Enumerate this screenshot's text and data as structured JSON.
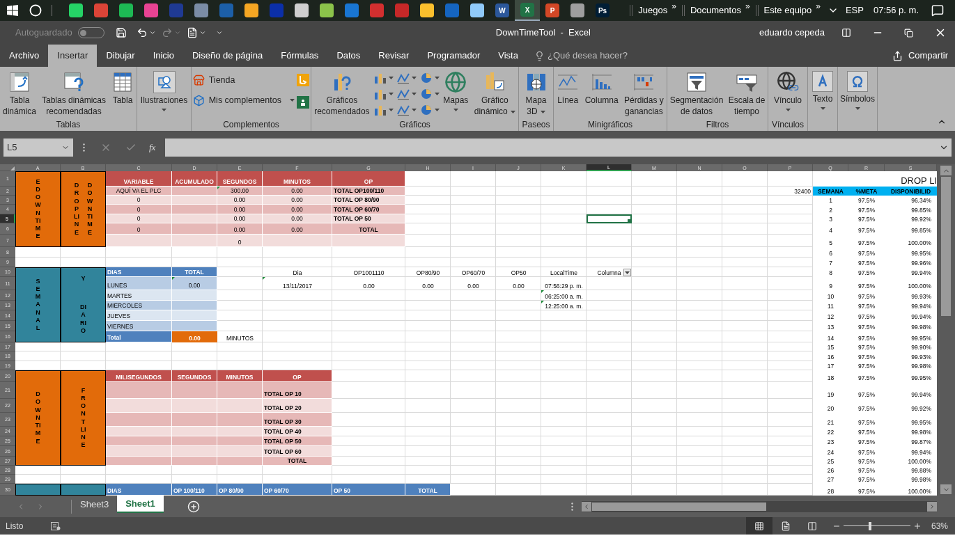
{
  "taskbar": {
    "apps": [
      {
        "color": "#25d366",
        "selected": false
      },
      {
        "color": "#db4437",
        "selected": false
      },
      {
        "color": "#1db954",
        "selected": false
      },
      {
        "color": "#e84393",
        "selected": false
      },
      {
        "color": "#1f3a93",
        "selected": false
      },
      {
        "color": "#7a8ca5",
        "selected": false
      },
      {
        "color": "#1c5fa8",
        "selected": false
      },
      {
        "color": "#f5a623",
        "selected": false
      },
      {
        "color": "#0b2fa8",
        "selected": false
      },
      {
        "color": "#cfcfcf",
        "selected": false
      },
      {
        "color": "#8bc34a",
        "selected": false
      },
      {
        "color": "#1976d2",
        "selected": false
      },
      {
        "color": "#d32f2f",
        "selected": false
      },
      {
        "color": "#c62828",
        "selected": false
      },
      {
        "color": "#fbc02d",
        "selected": false
      },
      {
        "color": "#1565c0",
        "selected": false
      },
      {
        "color": "#90caf9",
        "selected": false
      },
      {
        "color": "#2b579a",
        "label": "W",
        "selected": false
      },
      {
        "color": "#217346",
        "label": "X",
        "selected": true
      },
      {
        "color": "#d24726",
        "label": "P",
        "selected": false
      },
      {
        "color": "#9e9e9e",
        "selected": false
      },
      {
        "color": "#001e36",
        "label": "Ps",
        "selected": false
      }
    ],
    "toolbars": [
      {
        "label": "Juegos",
        "more": "»"
      },
      {
        "label": "Documentos",
        "more": "»"
      },
      {
        "label": "Este equipo",
        "more": "»"
      }
    ],
    "language": "ESP",
    "clock": "07:56 p. m."
  },
  "window": {
    "autosave": {
      "label": "Autoguardado",
      "on": false
    },
    "title": "DownTimeTool  -  Excel",
    "user": "eduardo cepeda"
  },
  "tabs": [
    {
      "label": "Archivo",
      "selected": false
    },
    {
      "label": "Insertar",
      "selected": true
    },
    {
      "label": "Dibujar",
      "selected": false
    },
    {
      "label": "Inicio",
      "selected": false
    },
    {
      "label": "Diseño de página",
      "selected": false
    },
    {
      "label": "Fórmulas",
      "selected": false
    },
    {
      "label": "Datos",
      "selected": false
    },
    {
      "label": "Revisar",
      "selected": false
    },
    {
      "label": "Programador",
      "selected": false
    },
    {
      "label": "Vista",
      "selected": false
    }
  ],
  "tell_me": {
    "placeholder": "¿Qué desea hacer?"
  },
  "share": "Compartir",
  "ribbon": {
    "tables": {
      "label": "Tablas",
      "pivot": [
        "Tabla",
        "dinámica"
      ],
      "recommended_pivot": [
        "Tablas dinámicas",
        "recomendadas"
      ],
      "table": [
        "Tabla"
      ]
    },
    "illustrations": [
      "Ilustraciones"
    ],
    "addins": {
      "label": "Complementos",
      "store": "Tienda",
      "my_addins": "Mis complementos"
    },
    "charts": {
      "label": "Gráficos",
      "recommended": [
        "Gráficos",
        "recomendados"
      ],
      "maps": [
        "Mapas"
      ],
      "pivot_chart": [
        "Gráfico",
        "dinámico"
      ]
    },
    "tours": {
      "label": "Paseos",
      "map3d": [
        "Mapa",
        "3D"
      ]
    },
    "sparklines": {
      "label": "Minigráficos",
      "line": [
        "Línea"
      ],
      "column": [
        "Columna"
      ],
      "winloss": [
        "Pérdidas y",
        "ganancias"
      ]
    },
    "filters": {
      "label": "Filtros",
      "slicer": [
        "Segmentación",
        "de datos"
      ],
      "timeline": [
        "Escala de",
        "tiempo"
      ]
    },
    "links": {
      "label": "Vínculos",
      "link": [
        "Vínculo"
      ]
    },
    "text": [
      "Texto"
    ],
    "symbols": [
      "Símbolos"
    ]
  },
  "formula_bar": {
    "name_box": "L5",
    "function": "fx"
  },
  "sheet": {
    "columns": [
      {
        "label": "A",
        "selected": false
      },
      {
        "label": "B",
        "selected": false
      },
      {
        "label": "C",
        "selected": false
      },
      {
        "label": "D",
        "selected": false
      },
      {
        "label": "E",
        "selected": false
      },
      {
        "label": "F",
        "selected": false
      },
      {
        "label": "G",
        "selected": false
      },
      {
        "label": "H",
        "selected": false
      },
      {
        "label": "I",
        "selected": false
      },
      {
        "label": "J",
        "selected": false
      },
      {
        "label": "K",
        "selected": false
      },
      {
        "label": "L",
        "selected": true
      },
      {
        "label": "M",
        "selected": false
      },
      {
        "label": "N",
        "selected": false
      },
      {
        "label": "O",
        "selected": false
      },
      {
        "label": "P",
        "selected": false
      },
      {
        "label": "Q",
        "selected": false
      },
      {
        "label": "R",
        "selected": false
      },
      {
        "label": "S",
        "selected": false
      }
    ],
    "blocks": [
      {
        "kind": "orange",
        "lines": [
          "EDOWNTIME"
        ]
      },
      {
        "kind": "orangepair",
        "lines": [
          "DROPLINE",
          "DOWNTIME"
        ]
      },
      {
        "kind": "teal",
        "lines": [
          "SEMANAL"
        ]
      },
      {
        "kind": "tealstack",
        "lines": [
          "Y",
          "DIARIO"
        ]
      },
      {
        "kind": "orange",
        "lines": [
          "DOWNTIME"
        ]
      },
      {
        "kind": "orange",
        "lines": [
          "FRONTLINE"
        ]
      },
      {
        "kind": "teal"
      },
      {
        "kind": "teal"
      }
    ],
    "rows": [
      {
        "label": "1",
        "selected": false,
        "cells": [
          {
            "kind": "header",
            "text": "VARIABLE"
          },
          {
            "kind": "header",
            "text": "ACUMULADO"
          },
          {
            "kind": "header",
            "text": "SEGUNDOS"
          },
          {
            "kind": "header",
            "text": "MINUTOS"
          },
          {
            "kind": "header",
            "text": "OP"
          }
        ]
      },
      {
        "label": "2",
        "selected": false,
        "cells": [
          {
            "kind": "shade",
            "text": "AQUÍ VA EL PLC"
          },
          {
            "kind": "shade"
          },
          {
            "kind": "shade",
            "text": "300.00",
            "flag": true
          },
          {
            "kind": "shade",
            "text": "0.00"
          },
          {
            "kind": "shadeop",
            "text": "TOTAL OP100/110"
          },
          {
            "kind": "plain"
          },
          {
            "kind": "plain"
          },
          {
            "kind": "plain"
          },
          {
            "kind": "plain"
          },
          {
            "kind": "plain"
          },
          {
            "kind": "plain"
          },
          {
            "kind": "plain"
          },
          {
            "kind": "plain"
          },
          {
            "kind": "figure",
            "text": "32400"
          }
        ]
      },
      {
        "label": "3",
        "selected": false,
        "cells": [
          {
            "kind": "tint",
            "text": "0"
          },
          {
            "kind": "tint"
          },
          {
            "kind": "tint",
            "text": "0.00"
          },
          {
            "kind": "tint",
            "text": "0.00"
          },
          {
            "kind": "tintop",
            "text": "TOTAL OP 80/90"
          }
        ]
      },
      {
        "label": "4",
        "selected": false,
        "cells": [
          {
            "kind": "shade",
            "text": "0"
          },
          {
            "kind": "shade"
          },
          {
            "kind": "shade",
            "text": "0.00"
          },
          {
            "kind": "shade",
            "text": "0.00"
          },
          {
            "kind": "shadeop",
            "text": "TOTAL OP 60/70"
          }
        ]
      },
      {
        "label": "5",
        "selected": true,
        "cells": [
          {
            "kind": "tint",
            "text": "0"
          },
          {
            "kind": "tint"
          },
          {
            "kind": "tint",
            "text": "0.00"
          },
          {
            "kind": "tint",
            "text": "0.00"
          },
          {
            "kind": "tintop",
            "text": "TOTAL OP 50"
          }
        ]
      },
      {
        "label": "6",
        "selected": false,
        "cells": [
          {
            "kind": "shade",
            "text": "0"
          },
          {
            "kind": "shade"
          },
          {
            "kind": "shade",
            "text": "0.00"
          },
          {
            "kind": "shade",
            "text": "0.00"
          },
          {
            "kind": "shadetotal",
            "text": "TOTAL"
          }
        ]
      },
      {
        "label": "7",
        "selected": false,
        "cells": [
          {
            "kind": "tint"
          },
          {
            "kind": "tint"
          },
          {
            "kind": "tint",
            "text": "0"
          },
          {
            "kind": "tint"
          },
          {
            "kind": "tint"
          }
        ]
      },
      {
        "label": "8",
        "selected": false
      },
      {
        "label": "9",
        "selected": false
      },
      {
        "label": "10",
        "selected": false,
        "cells": [
          {
            "kind": "bluetitle",
            "text": "DIAS"
          },
          {
            "kind": "bluehead",
            "text": "TOTAL"
          },
          {
            "kind": "plain"
          },
          {
            "kind": "plain",
            "text": "Dia"
          },
          {
            "kind": "plain",
            "text": "OP1001110"
          },
          {
            "kind": "plain",
            "text": "OP80/90"
          },
          {
            "kind": "plain",
            "text": "OP60/70"
          },
          {
            "kind": "plain",
            "text": "OP50"
          },
          {
            "kind": "plain",
            "text": "LocalTime"
          },
          {
            "kind": "plain",
            "text": "Columna",
            "filter": true
          }
        ]
      },
      {
        "label": "11",
        "selected": false,
        "cells": [
          {
            "kind": "daydark",
            "text": "LUNES"
          },
          {
            "kind": "bluedark",
            "text": "0.00",
            "flag": true
          },
          {
            "kind": "plain"
          },
          {
            "kind": "plain",
            "text": "13/11/2017",
            "flag": true
          },
          {
            "kind": "plain",
            "text": "0.00"
          },
          {
            "kind": "plain",
            "text": "0.00"
          },
          {
            "kind": "plain",
            "text": "0.00"
          },
          {
            "kind": "plain",
            "text": "0.00"
          },
          {
            "kind": "plain",
            "text": "07:56:29 p. m."
          }
        ]
      },
      {
        "label": "12",
        "selected": false,
        "cells": [
          {
            "kind": "daylight",
            "text": "MARTES"
          },
          {
            "kind": "bluelight"
          },
          {
            "kind": "plain"
          },
          {
            "kind": "plain"
          },
          {
            "kind": "plain"
          },
          {
            "kind": "plain"
          },
          {
            "kind": "plain"
          },
          {
            "kind": "plain"
          },
          {
            "kind": "plain",
            "text": "06:25:00 a. m.",
            "flag": true
          }
        ]
      },
      {
        "label": "13",
        "selected": false,
        "cells": [
          {
            "kind": "daydark",
            "text": "MIERCOLES"
          },
          {
            "kind": "bluedark"
          },
          {
            "kind": "plain"
          },
          {
            "kind": "plain"
          },
          {
            "kind": "plain"
          },
          {
            "kind": "plain"
          },
          {
            "kind": "plain"
          },
          {
            "kind": "plain"
          },
          {
            "kind": "plain",
            "text": "12:25:00 a. m.",
            "flag": true
          }
        ]
      },
      {
        "label": "14",
        "selected": false,
        "cells": [
          {
            "kind": "daylight",
            "text": "JUEVES"
          },
          {
            "kind": "bluelight"
          }
        ]
      },
      {
        "label": "15",
        "selected": false,
        "cells": [
          {
            "kind": "daydark",
            "text": "VIERNES"
          },
          {
            "kind": "bluedark"
          }
        ]
      },
      {
        "label": "16",
        "selected": false,
        "cells": [
          {
            "kind": "bluetitle",
            "text": "Total"
          },
          {
            "kind": "orange",
            "text": "0.00"
          },
          {
            "kind": "plain",
            "text": "MINUTOS"
          }
        ]
      },
      {
        "label": "17",
        "selected": false
      },
      {
        "label": "18",
        "selected": false
      },
      {
        "label": "19",
        "selected": false
      },
      {
        "label": "20",
        "selected": false,
        "cells": [
          {
            "kind": "header",
            "text": "MILISEGUNDOS"
          },
          {
            "kind": "header",
            "text": "SEGUNDOS"
          },
          {
            "kind": "header",
            "text": "MINUTOS"
          },
          {
            "kind": "header",
            "text": "OP"
          }
        ]
      },
      {
        "label": "21",
        "selected": false,
        "cells": [
          {
            "kind": "shade"
          },
          {
            "kind": "shade"
          },
          {
            "kind": "shade"
          },
          {
            "kind": "shadeop",
            "text": "TOTAL OP 10"
          }
        ]
      },
      {
        "label": "22",
        "selected": false,
        "cells": [
          {
            "kind": "tint"
          },
          {
            "kind": "tint"
          },
          {
            "kind": "tint"
          },
          {
            "kind": "tintop",
            "text": "TOTAL OP 20"
          }
        ]
      },
      {
        "label": "23",
        "selected": false,
        "cells": [
          {
            "kind": "shade"
          },
          {
            "kind": "shade"
          },
          {
            "kind": "shade"
          },
          {
            "kind": "shadeop",
            "text": "TOTAL OP 30"
          }
        ]
      },
      {
        "label": "24",
        "selected": false,
        "cells": [
          {
            "kind": "tint"
          },
          {
            "kind": "tint"
          },
          {
            "kind": "tint"
          },
          {
            "kind": "tintop",
            "text": "TOTAL OP 40"
          }
        ]
      },
      {
        "label": "25",
        "selected": false,
        "cells": [
          {
            "kind": "shade"
          },
          {
            "kind": "shade"
          },
          {
            "kind": "shade"
          },
          {
            "kind": "shadeop",
            "text": "TOTAL OP 50"
          }
        ]
      },
      {
        "label": "26",
        "selected": false,
        "cells": [
          {
            "kind": "tint"
          },
          {
            "kind": "tint"
          },
          {
            "kind": "tint"
          },
          {
            "kind": "tintop",
            "text": "TOTAL OP 60"
          }
        ]
      },
      {
        "label": "27",
        "selected": false,
        "cells": [
          {
            "kind": "shade"
          },
          {
            "kind": "shade"
          },
          {
            "kind": "shade"
          },
          {
            "kind": "shadetotal",
            "text": "TOTAL"
          }
        ]
      },
      {
        "label": "28",
        "selected": false
      },
      {
        "label": "29",
        "selected": false
      },
      {
        "label": "30",
        "selected": false,
        "cells": [
          {
            "kind": "bluetitle",
            "text": "DIAS"
          },
          {
            "kind": "bluetitle",
            "text": "OP 100/110"
          },
          {
            "kind": "bluetitle",
            "text": "OP 80/90"
          },
          {
            "kind": "bluetitle",
            "text": "OP 60/70"
          },
          {
            "kind": "bluetitle",
            "text": "OP 50"
          },
          {
            "kind": "bluehead",
            "text": "TOTAL"
          }
        ]
      }
    ],
    "availability": {
      "title": "DROP LI",
      "columns": [
        "SEMANA",
        "%META",
        "DISPONIBILID"
      ],
      "rows": [
        [
          "1",
          "97.5%",
          "96.34%"
        ],
        [
          "2",
          "97.5%",
          "99.85%"
        ],
        [
          "3",
          "97.5%",
          "99.92%"
        ],
        [
          "4",
          "97.5%",
          "99.85%"
        ],
        [
          "5",
          "97.5%",
          "100.00%"
        ],
        [
          "6",
          "97.5%",
          "99.95%"
        ],
        [
          "7",
          "97.5%",
          "99.96%"
        ],
        [
          "8",
          "97.5%",
          "99.94%"
        ],
        [
          "9",
          "97.5%",
          "100.00%"
        ],
        [
          "10",
          "97.5%",
          "99.93%"
        ],
        [
          "11",
          "97.5%",
          "99.94%"
        ],
        [
          "12",
          "97.5%",
          "99.94%"
        ],
        [
          "13",
          "97.5%",
          "99.98%"
        ],
        [
          "14",
          "97.5%",
          "99.95%"
        ],
        [
          "15",
          "97.5%",
          "99.90%"
        ],
        [
          "16",
          "97.5%",
          "99.93%"
        ],
        [
          "17",
          "97.5%",
          "99.98%"
        ],
        [
          "18",
          "97.5%",
          "99.95%"
        ],
        [
          "19",
          "97.5%",
          "99.94%"
        ],
        [
          "20",
          "97.5%",
          "99.92%"
        ],
        [
          "21",
          "97.5%",
          "99.95%"
        ],
        [
          "22",
          "97.5%",
          "99.98%"
        ],
        [
          "23",
          "97.5%",
          "99.87%"
        ],
        [
          "24",
          "97.5%",
          "99.94%"
        ],
        [
          "25",
          "97.5%",
          "100.00%"
        ],
        [
          "26",
          "97.5%",
          "99.88%"
        ],
        [
          "27",
          "97.5%",
          "99.98%"
        ],
        [
          "28",
          "97.5%",
          "100.00%"
        ]
      ]
    }
  },
  "sheet_tabs": [
    {
      "label": "Sheet3",
      "selected": false
    },
    {
      "label": "Sheet1",
      "selected": true
    }
  ],
  "status_bar": {
    "status": "Listo",
    "views": [
      {
        "selected": true
      },
      {
        "selected": false
      },
      {
        "selected": false
      }
    ],
    "zoom": {
      "level": 0.38,
      "reading": "63%"
    }
  }
}
